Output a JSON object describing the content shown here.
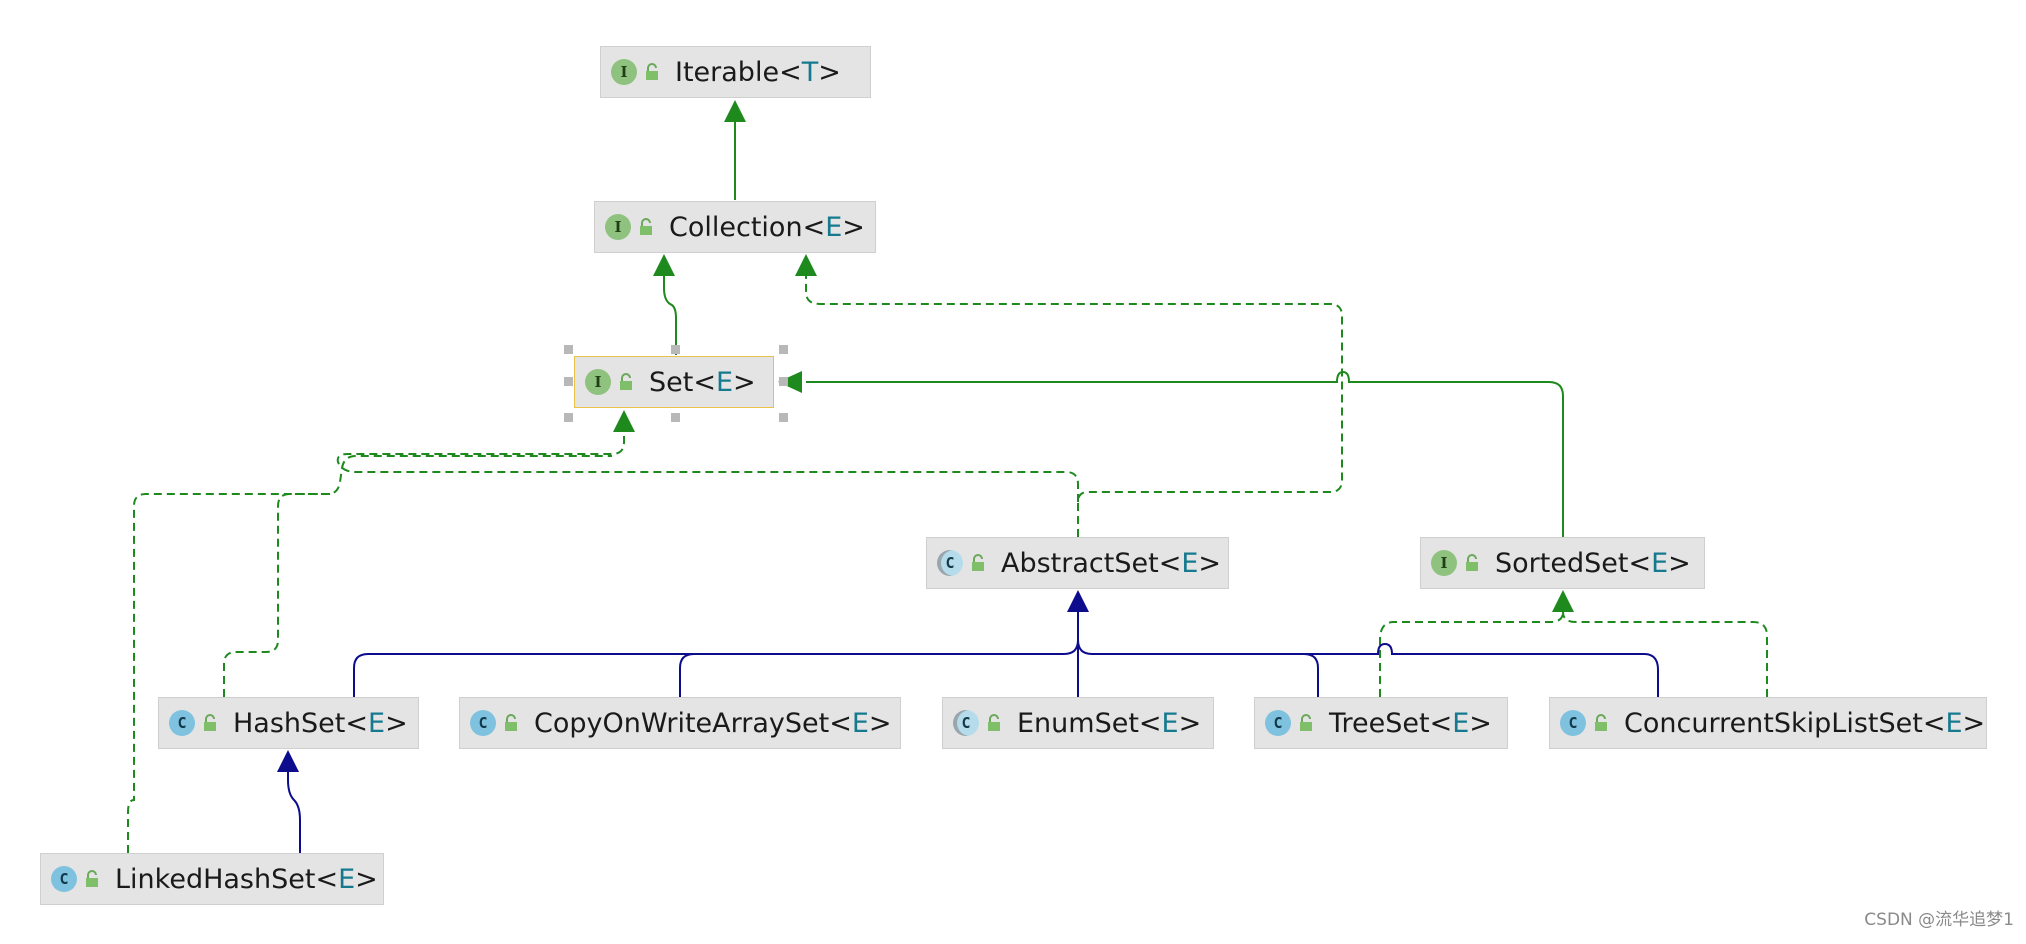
{
  "diagram": {
    "type": "uml-class-hierarchy",
    "nodes": {
      "iterable": {
        "kind": "interface",
        "name": "Iterable",
        "type_param": "T"
      },
      "collection": {
        "kind": "interface",
        "name": "Collection",
        "type_param": "E"
      },
      "set": {
        "kind": "interface",
        "name": "Set",
        "type_param": "E",
        "selected": true
      },
      "abstract_set": {
        "kind": "abstract",
        "name": "AbstractSet",
        "type_param": "E"
      },
      "sorted_set": {
        "kind": "interface",
        "name": "SortedSet",
        "type_param": "E"
      },
      "hash_set": {
        "kind": "class",
        "name": "HashSet",
        "type_param": "E"
      },
      "cow_set": {
        "kind": "class",
        "name": "CopyOnWriteArraySet",
        "type_param": "E"
      },
      "enum_set": {
        "kind": "abstract",
        "name": "EnumSet",
        "type_param": "E"
      },
      "tree_set": {
        "kind": "class",
        "name": "TreeSet",
        "type_param": "E"
      },
      "csl_set": {
        "kind": "class",
        "name": "ConcurrentSkipListSet",
        "type_param": "E"
      },
      "linked_hash_set": {
        "kind": "class",
        "name": "LinkedHashSet",
        "type_param": "E"
      }
    },
    "badges": {
      "interface": "I",
      "class": "C",
      "abstract": "C"
    },
    "edges": [
      {
        "from": "collection",
        "to": "iterable",
        "relation": "extends-interface"
      },
      {
        "from": "set",
        "to": "collection",
        "relation": "extends-interface"
      },
      {
        "from": "sorted_set",
        "to": "set",
        "relation": "extends-interface"
      },
      {
        "from": "abstract_set",
        "to": "set",
        "relation": "implements"
      },
      {
        "from": "abstract_set",
        "to": "collection",
        "relation": "implements"
      },
      {
        "from": "hash_set",
        "to": "set",
        "relation": "implements"
      },
      {
        "from": "linked_hash_set",
        "to": "set",
        "relation": "implements"
      },
      {
        "from": "tree_set",
        "to": "sorted_set",
        "relation": "implements"
      },
      {
        "from": "csl_set",
        "to": "sorted_set",
        "relation": "implements"
      },
      {
        "from": "hash_set",
        "to": "abstract_set",
        "relation": "extends-class"
      },
      {
        "from": "cow_set",
        "to": "abstract_set",
        "relation": "extends-class"
      },
      {
        "from": "enum_set",
        "to": "abstract_set",
        "relation": "extends-class"
      },
      {
        "from": "tree_set",
        "to": "abstract_set",
        "relation": "extends-class"
      },
      {
        "from": "csl_set",
        "to": "abstract_set",
        "relation": "extends-class"
      },
      {
        "from": "linked_hash_set",
        "to": "hash_set",
        "relation": "extends-class"
      }
    ],
    "colors": {
      "interface_edge": "#1e8a1e",
      "class_edge": "#0c0c8c",
      "interface_badge": "#8fc27f",
      "class_badge": "#7fc2df",
      "type_param": "#157a8f",
      "selection_border": "#e9c24a"
    }
  },
  "watermark": "CSDN @流华追梦1"
}
